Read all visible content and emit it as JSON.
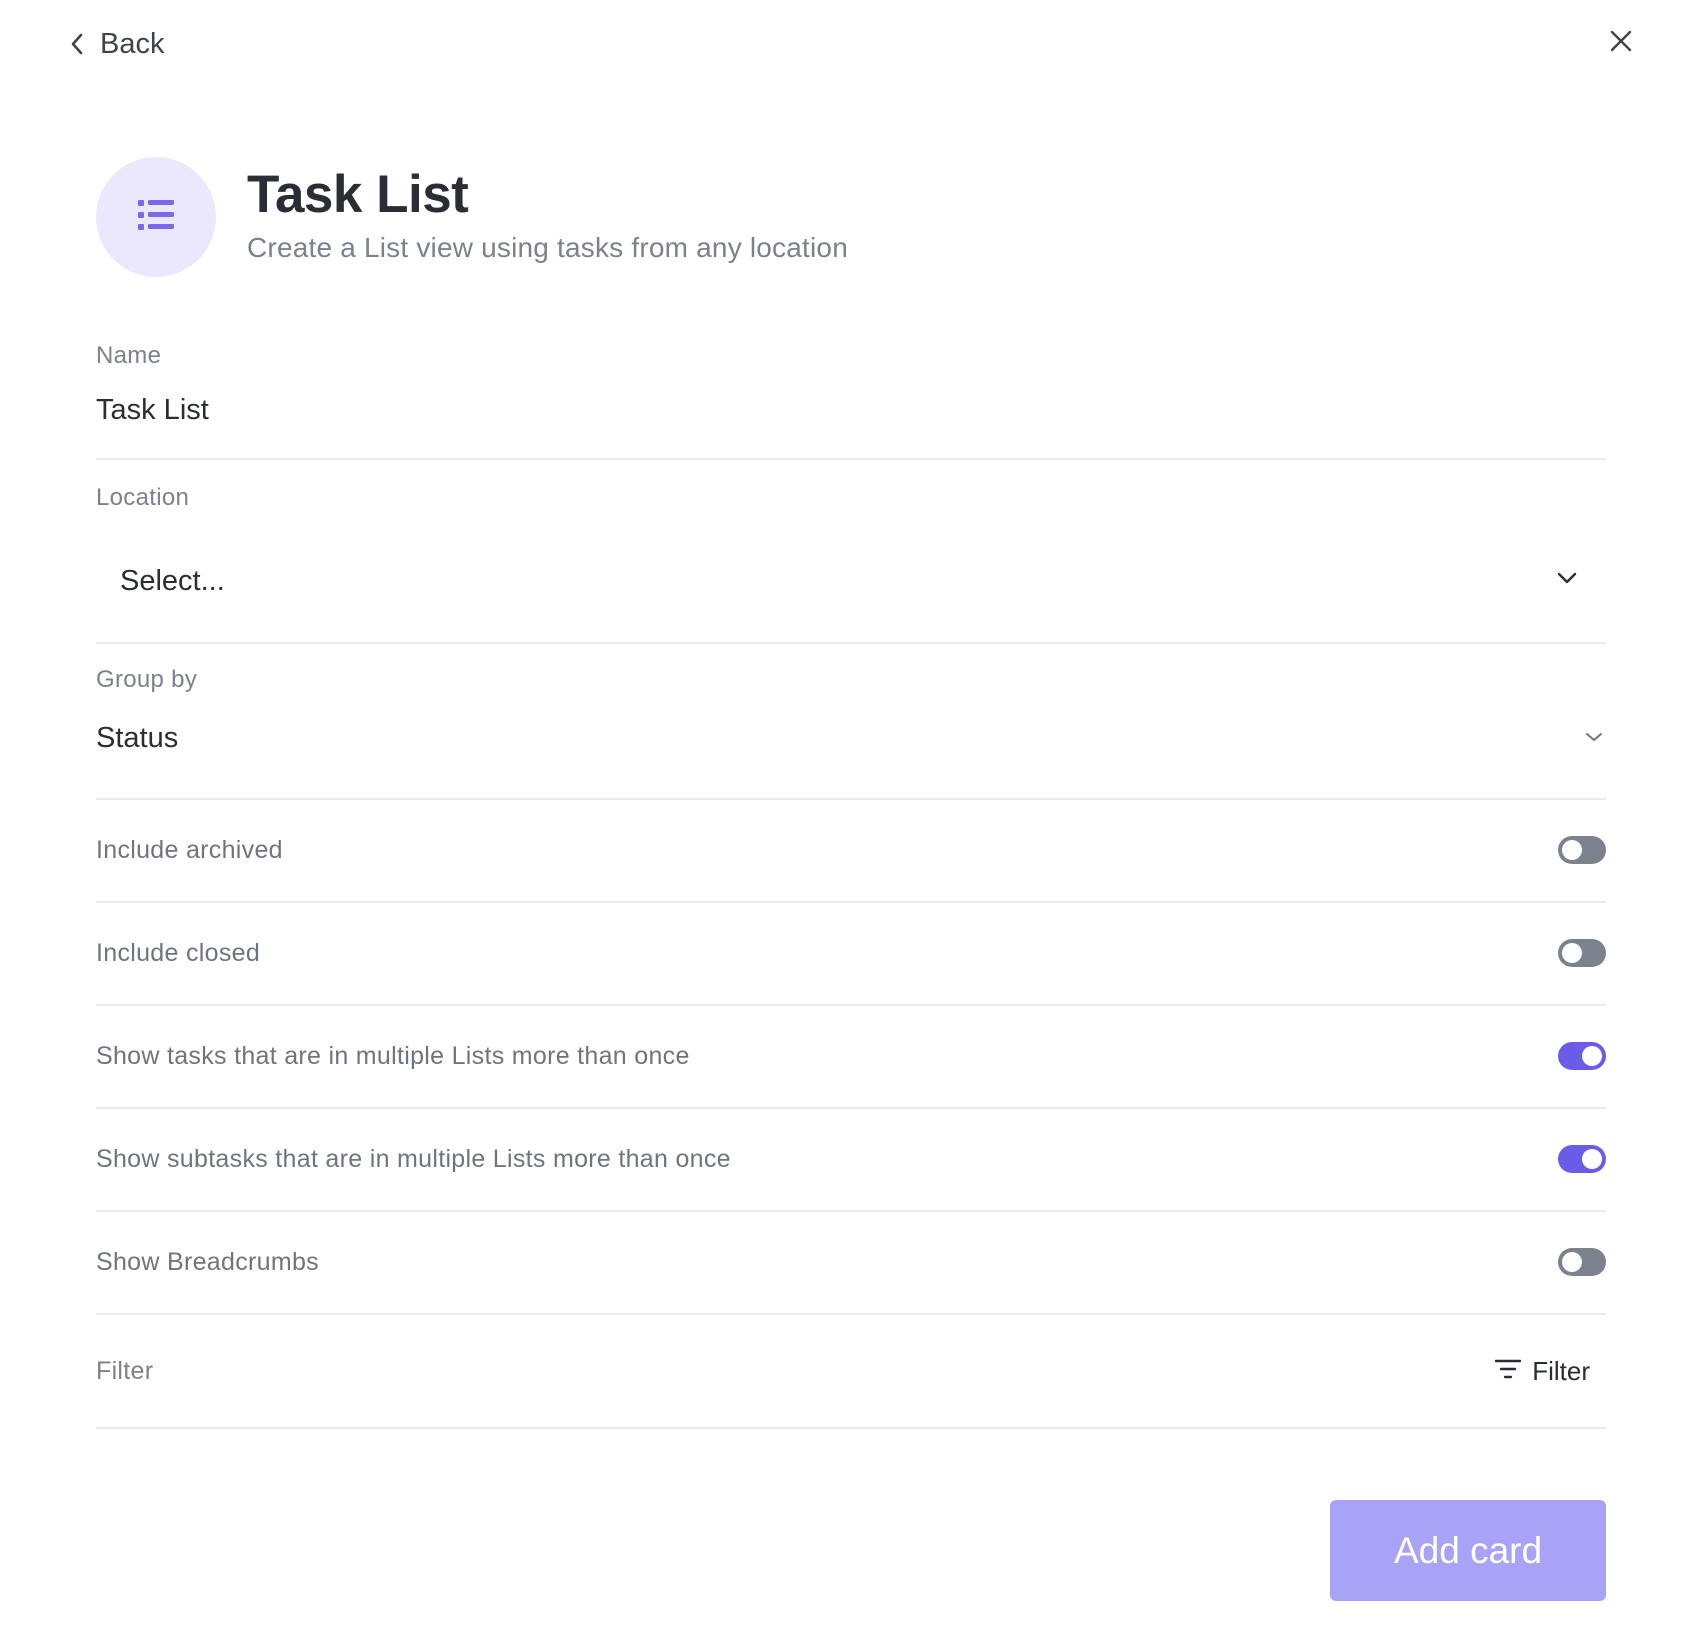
{
  "nav": {
    "back_label": "Back",
    "back_icon": "chevron-left-icon",
    "close_icon": "close-icon"
  },
  "header": {
    "icon": "list-icon",
    "title": "Task List",
    "subtitle": "Create a List view using tasks from any location"
  },
  "fields": {
    "name": {
      "label": "Name",
      "value": "Task List"
    },
    "location": {
      "label": "Location",
      "value": "Select..."
    },
    "group_by": {
      "label": "Group by",
      "value": "Status"
    }
  },
  "toggles": [
    {
      "label": "Include archived",
      "on": false
    },
    {
      "label": "Include closed",
      "on": false
    },
    {
      "label": "Show tasks that are in multiple Lists more than once",
      "on": true
    },
    {
      "label": "Show subtasks that are in multiple Lists more than once",
      "on": true
    },
    {
      "label": "Show Breadcrumbs",
      "on": false
    }
  ],
  "filter": {
    "label": "Filter",
    "button_label": "Filter",
    "button_icon": "filter-icon"
  },
  "footer": {
    "add_card_label": "Add card"
  },
  "colors": {
    "accent": "#6b5ce7",
    "accent_disabled": "#a8a3f6",
    "icon_bg": "#ebe7fc",
    "toggle_off": "#7c828d"
  }
}
